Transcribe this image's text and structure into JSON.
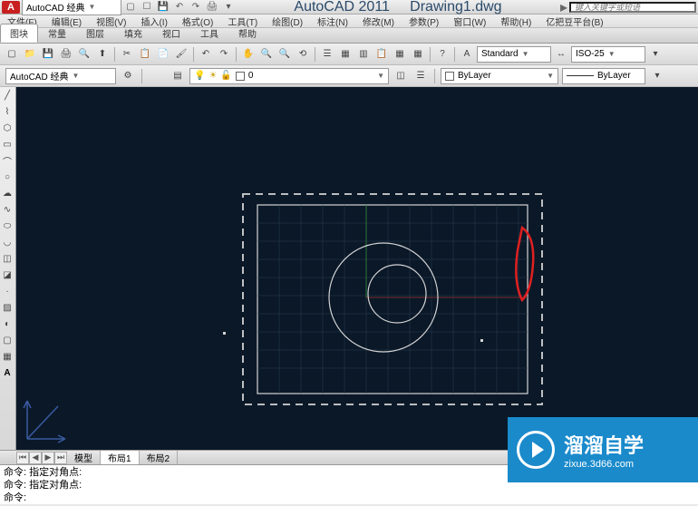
{
  "app": {
    "name": "AutoCAD 2011",
    "document": "Drawing1.dwg",
    "search_placeholder": "键入关键字或短语"
  },
  "quick_access": {
    "workspace": "AutoCAD 经典"
  },
  "menu": {
    "file": "文件(F)",
    "edit": "编辑(E)",
    "view": "视图(V)",
    "insert": "插入(I)",
    "format": "格式(O)",
    "tools": "工具(T)",
    "draw": "绘图(D)",
    "dimension": "标注(N)",
    "modify": "修改(M)",
    "param": "参数(P)",
    "window": "窗口(W)",
    "help": "帮助(H)",
    "platform": "亿把豆平台(B)"
  },
  "tabs": {
    "items": [
      "图块",
      "常量",
      "图层",
      "填充",
      "视口",
      "工具",
      "帮助"
    ],
    "active": 0
  },
  "toolbar": {
    "text_style": "Standard",
    "dim_style": "ISO-25",
    "layer_name": "0",
    "bylayer": "ByLayer",
    "workspace": "AutoCAD 经典"
  },
  "bottom_tabs": {
    "model": "模型",
    "layout1": "布局1",
    "layout2": "布局2"
  },
  "command": {
    "line1": "命令: 指定对角点:",
    "line2": "命令: 指定对角点:",
    "prompt": "命令:"
  },
  "watermark": {
    "title": "溜溜自学",
    "url": "zixue.3d66.com"
  }
}
